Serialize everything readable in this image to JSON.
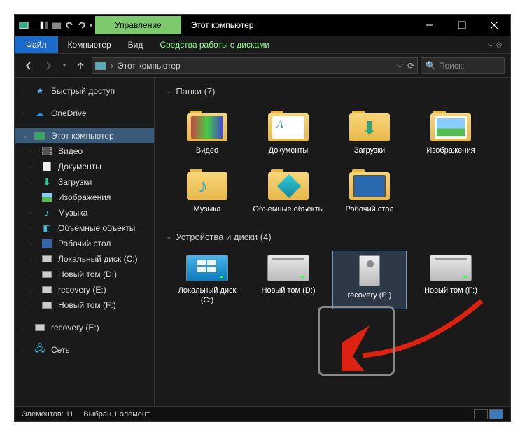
{
  "titlebar": {
    "manage": "Управление",
    "title": "Этот компьютер"
  },
  "ribbon": {
    "file": "Файл",
    "tabs": [
      "Компьютер",
      "Вид"
    ],
    "tool": "Средства работы с дисками"
  },
  "nav": {
    "location": "Этот компьютер",
    "search_placeholder": "Поиск:"
  },
  "sidebar": {
    "quick": "Быстрый доступ",
    "onedrive": "OneDrive",
    "thispc": "Этот компьютер",
    "children": [
      {
        "label": "Видео"
      },
      {
        "label": "Документы"
      },
      {
        "label": "Загрузки"
      },
      {
        "label": "Изображения"
      },
      {
        "label": "Музыка"
      },
      {
        "label": "Объемные объекты"
      },
      {
        "label": "Рабочий стол"
      },
      {
        "label": "Локальный диск (C:)"
      },
      {
        "label": "Новый том (D:)"
      },
      {
        "label": "recovery (E:)"
      },
      {
        "label": "Новый том (F:)"
      }
    ],
    "recovery_ext": "recovery (E:)",
    "network": "Сеть"
  },
  "content": {
    "group_folders": "Папки (7)",
    "folders": [
      {
        "label": "Видео"
      },
      {
        "label": "Документы"
      },
      {
        "label": "Загрузки"
      },
      {
        "label": "Изображения"
      },
      {
        "label": "Музыка"
      },
      {
        "label": "Объемные объекты"
      },
      {
        "label": "Рабочий стол"
      }
    ],
    "group_drives": "Устройства и диски (4)",
    "drives": [
      {
        "label": "Локальный диск (C:)"
      },
      {
        "label": "Новый том (D:)"
      },
      {
        "label": "recovery (E:)"
      },
      {
        "label": "Новый том (F:)"
      }
    ]
  },
  "status": {
    "count": "Элементов: 11",
    "selected": "Выбран 1 элемент"
  }
}
